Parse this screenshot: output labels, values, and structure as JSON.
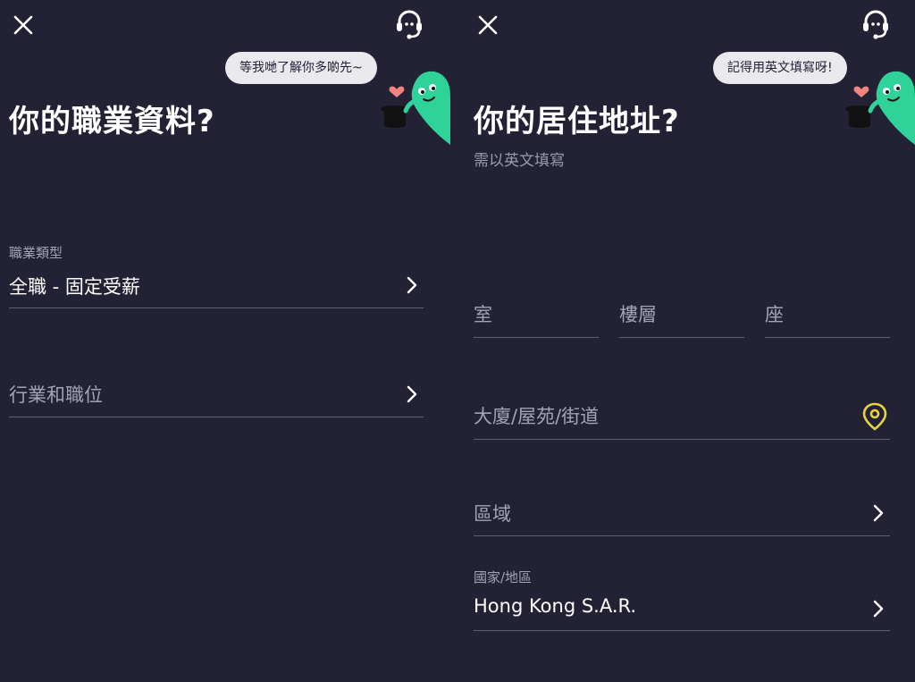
{
  "left": {
    "bubble_text": "等我哋了解你多啲先~",
    "title": "你的職業資料?",
    "employment_type": {
      "label": "職業類型",
      "value": "全職 - 固定受薪"
    },
    "industry_position": {
      "placeholder": "行業和職位"
    }
  },
  "right": {
    "bubble_text": "記得用英文填寫呀!",
    "title": "你的居住地址?",
    "subtitle": "需以英文填寫",
    "flat": {
      "placeholder": "室"
    },
    "floor": {
      "placeholder": "樓層"
    },
    "block": {
      "placeholder": "座"
    },
    "building": {
      "placeholder": "大廈/屋苑/街道"
    },
    "district": {
      "placeholder": "區域"
    },
    "country": {
      "label": "國家/地區",
      "value": "Hong Kong S.A.R."
    }
  },
  "colors": {
    "background": "#222234",
    "mascot_green": "#2fd39a",
    "heart": "#f2857f",
    "pin_yellow": "#e9d33c",
    "divider": "#5f5f72"
  },
  "icons": [
    "close-icon",
    "headset-icon",
    "chevron-right-icon",
    "location-pin-icon",
    "heart-icon",
    "magic-hat-icon"
  ]
}
